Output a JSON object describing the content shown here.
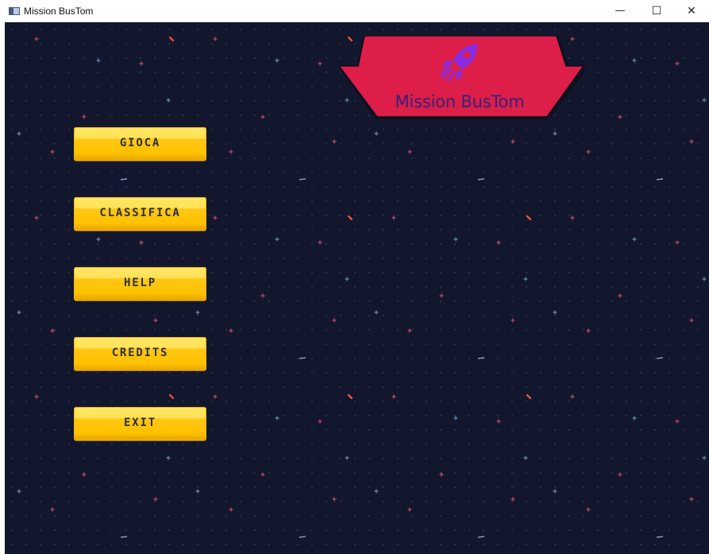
{
  "window": {
    "title": "Mission BusTom",
    "controls": {
      "minimize": "—",
      "maximize": "☐",
      "close": "✕"
    }
  },
  "game": {
    "title": "Mission BusTom",
    "logo_icon": "rocket-icon"
  },
  "menu": {
    "play_label": "GIOCA",
    "leaderboard_label": "CLASSIFICA",
    "help_label": "HELP",
    "credits_label": "CREDITS",
    "exit_label": "EXIT"
  },
  "colors": {
    "background": "#13172d",
    "banner": "#dc1e48",
    "title_text": "#33227a",
    "rocket": "#8a2be2",
    "button": "#ffc200",
    "button_text": "#2b2f3d"
  }
}
